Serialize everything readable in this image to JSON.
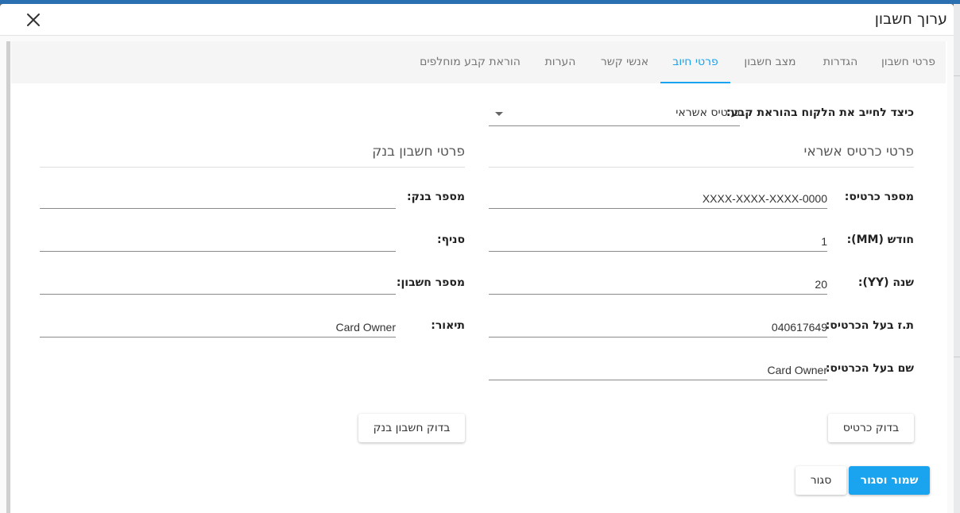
{
  "dialog": {
    "title": "ערוך חשבון"
  },
  "tabs": [
    {
      "label": "פרטי חשבון"
    },
    {
      "label": "הגדרות"
    },
    {
      "label": "מצב חשבון"
    },
    {
      "label": "פרטי חיוב"
    },
    {
      "label": "אנשי קשר"
    },
    {
      "label": "הערות"
    },
    {
      "label": "הוראת קבע מוחלפים"
    }
  ],
  "active_tab": "פרטי חיוב",
  "billing": {
    "charge_method_label": "כיצד לחייב את הלקוח בהוראת קבע:",
    "charge_method_value": "כרטיס אשראי"
  },
  "credit": {
    "title": "פרטי כרטיס אשראי",
    "card_number_label": "מספר כרטיס:",
    "card_number_value": "XXXX-XXXX-XXXX-0000",
    "month_label": "חודש (MM):",
    "month_value": "1",
    "year_label": "שנה (YY):",
    "year_value": "20",
    "owner_id_label": "ת.ז בעל הכרטיס:",
    "owner_id_value": "040617649",
    "owner_name_label": "שם בעל הכרטיס:",
    "owner_name_value": "Card Owner",
    "check_button": "בדוק כרטיס"
  },
  "bank": {
    "title": "פרטי חשבון בנק",
    "bank_number_label": "מספר בנק:",
    "bank_number_value": "",
    "branch_label": "סניף:",
    "branch_value": "",
    "account_number_label": "מספר חשבון:",
    "account_number_value": "",
    "description_label": "תיאור:",
    "description_value": "Card Owner",
    "check_button": "בדוק חשבון בנק"
  },
  "footer": {
    "save_close": "שמור וסגור",
    "close": "סגור"
  },
  "colors": {
    "accent": "#1aa3ee",
    "header_strip": "#2a6fb0"
  },
  "icons": {
    "close": "close-icon",
    "dropdown": "chevron-down-icon"
  }
}
